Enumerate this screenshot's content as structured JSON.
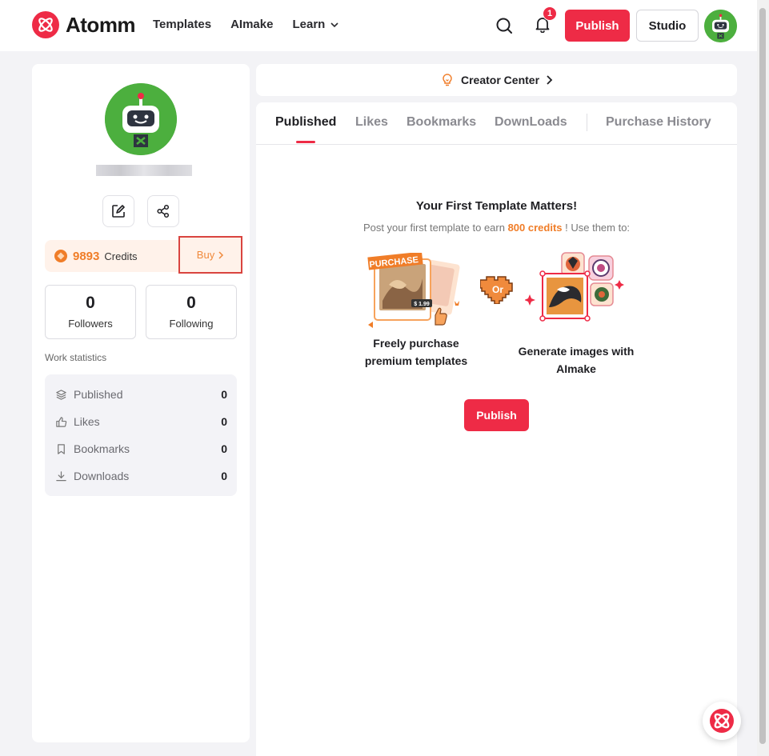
{
  "header": {
    "logo_text": "Atomm",
    "nav": [
      {
        "label": "Templates"
      },
      {
        "label": "AImake"
      },
      {
        "label": "Learn"
      }
    ],
    "notification_count": "1",
    "publish_label": "Publish",
    "studio_label": "Studio"
  },
  "profile": {
    "credits_value": "9893",
    "credits_label": "Credits",
    "buy_label": "Buy",
    "followers_count": "0",
    "followers_label": "Followers",
    "following_count": "0",
    "following_label": "Following",
    "work_statistics_title": "Work statistics",
    "work_stats": [
      {
        "label": "Published",
        "value": "0"
      },
      {
        "label": "Likes",
        "value": "0"
      },
      {
        "label": "Bookmarks",
        "value": "0"
      },
      {
        "label": "Downloads",
        "value": "0"
      }
    ]
  },
  "creator_center": {
    "label": "Creator Center"
  },
  "tabs": [
    {
      "label": "Published"
    },
    {
      "label": "Likes"
    },
    {
      "label": "Bookmarks"
    },
    {
      "label": "DownLoads"
    },
    {
      "label": "Purchase History"
    }
  ],
  "empty_state": {
    "title": "Your First Template Matters!",
    "subtitle_before": "Post your first template to earn ",
    "subtitle_highlight": "800 credits",
    "subtitle_after": " ! Use them to:",
    "promo_left_badge": "PURCHASE",
    "promo_left_price": "$ 1.99",
    "promo_or": "Or",
    "promo_left_caption": "Freely purchase premium templates",
    "promo_right_caption": "Generate images with AImake",
    "publish_label": "Publish"
  },
  "colors": {
    "brand": "#ee2b46",
    "credits_accent": "#f07d28",
    "avatar_green": "#4caf3e"
  }
}
